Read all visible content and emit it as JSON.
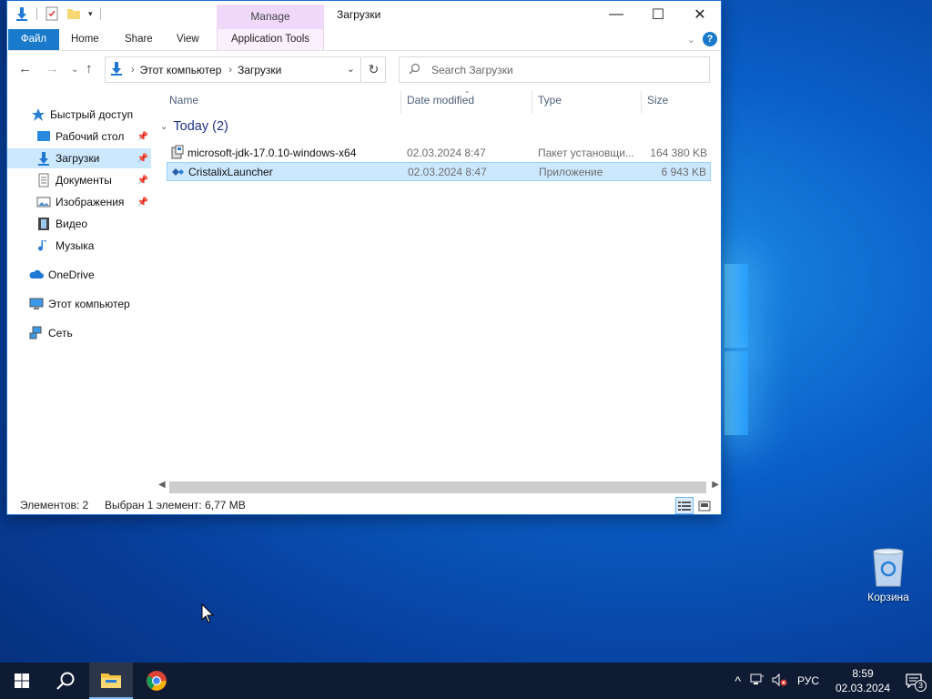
{
  "window": {
    "title": "Загрузки",
    "manage_label": "Manage",
    "tabs": {
      "file": "Файл",
      "home": "Home",
      "share": "Share",
      "view": "View",
      "app_tools": "Application Tools"
    }
  },
  "address": {
    "crumbs": [
      "Этот компьютер",
      "Загрузки"
    ]
  },
  "search": {
    "placeholder": "Search Загрузки"
  },
  "nav_pane": {
    "items": [
      {
        "label": "Быстрый доступ"
      },
      {
        "label": "Рабочий стол"
      },
      {
        "label": "Загрузки"
      },
      {
        "label": "Документы"
      },
      {
        "label": "Изображения"
      },
      {
        "label": "Видео"
      },
      {
        "label": "Музыка"
      },
      {
        "label": "OneDrive"
      },
      {
        "label": "Этот компьютер"
      },
      {
        "label": "Сеть"
      }
    ]
  },
  "columns": {
    "name": "Name",
    "date": "Date modified",
    "type": "Type",
    "size": "Size"
  },
  "group": {
    "label": "Today (2)"
  },
  "files": [
    {
      "name": "microsoft-jdk-17.0.10-windows-x64",
      "date": "02.03.2024 8:47",
      "type": "Пакет установщи...",
      "size": "164 380 KB",
      "selected": false
    },
    {
      "name": "CristalixLauncher",
      "date": "02.03.2024 8:47",
      "type": "Приложение",
      "size": "6 943 KB",
      "selected": true
    }
  ],
  "status": {
    "count": "Элементов: 2",
    "selection": "Выбран 1 элемент: 6,77 MB"
  },
  "desktop": {
    "recycle_label": "Корзина"
  },
  "taskbar": {
    "lang": "РУС",
    "time": "8:59",
    "date": "02.03.2024",
    "notif_count": "3"
  },
  "colors": {
    "accent": "#1979ca",
    "selection": "#cce8ff",
    "manage": "#f0d8fa"
  }
}
